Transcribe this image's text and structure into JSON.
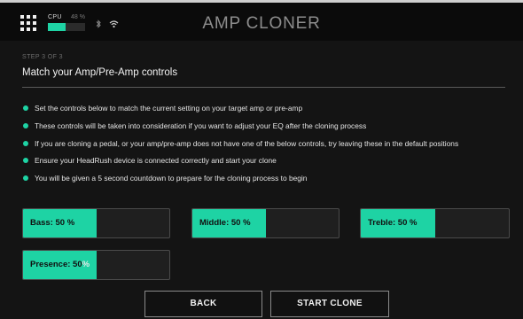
{
  "header": {
    "cpu_label": "CPU",
    "cpu_percent_text": "48 %",
    "cpu_level": 0.48,
    "app_title": "AMP CLONER"
  },
  "wizard": {
    "step": "STEP 3 OF 3",
    "title": "Match your Amp/Pre-Amp controls",
    "instructions": [
      "Set the controls below to match the current setting on your target amp or pre-amp",
      "These controls will be taken into consideration if you want to adjust your EQ after the cloning process",
      "If you are cloning a pedal, or your amp/pre-amp does not have one of the below controls, try leaving these in the default positions",
      "Ensure your HeadRush device is connected correctly and start your clone",
      "You will be given a 5 second countdown to prepare for the cloning process to begin"
    ]
  },
  "controls": {
    "bass": {
      "name": "Bass: 50",
      "unit": "%",
      "level": 50
    },
    "middle": {
      "name": "Middle: 50",
      "unit": "%",
      "level": 50
    },
    "treble": {
      "name": "Treble: 50",
      "unit": "%",
      "level": 50
    },
    "presence": {
      "name": "Presence: 50",
      "unit": "%",
      "level": 50
    }
  },
  "buttons": {
    "back": "BACK",
    "start": "START CLONE"
  },
  "colors": {
    "accent": "#1ed3a4",
    "background": "#141414"
  }
}
